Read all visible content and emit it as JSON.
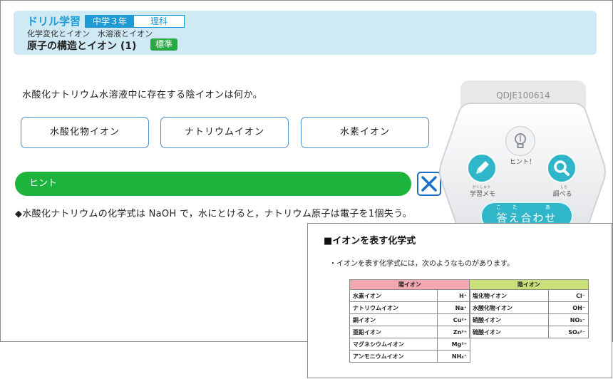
{
  "header": {
    "brand": "ドリル学習",
    "grade": "中学３年",
    "subject": "理科",
    "unit_path": "化学変化とイオン　水溶液とイオン",
    "unit_title": "原子の構造とイオン (1)",
    "level": "標準"
  },
  "question": {
    "text": "水酸化ナトリウム水溶液中に存在する陰イオンは何か。",
    "choices": [
      "水酸化物イオン",
      "ナトリウムイオン",
      "水素イオン"
    ]
  },
  "hint": {
    "label": "ヒント",
    "text": "◆水酸化ナトリウムの化学式は NaOH で，水にとけると，ナトリウム原子は電子を1個失う。"
  },
  "side_panel": {
    "question_id": "QDJE100614",
    "hint_button_label": "ヒント！",
    "memo_ruby": "がくしゅう",
    "memo_label": "学習メモ",
    "lookup_ruby": "しら",
    "lookup_label": "調べる",
    "answer_ruby": "こた　あ",
    "answer_label": "答え合わせ"
  },
  "card": {
    "title": "■イオンを表す化学式",
    "description": "・イオンを表す化学式には，次のようなものがあります。",
    "cation_header": "陽イオン",
    "anion_header": "陰イオン",
    "cations": [
      {
        "name": "水素イオン",
        "formula": "H⁺"
      },
      {
        "name": "ナトリウムイオン",
        "formula": "Na⁺"
      },
      {
        "name": "銅イオン",
        "formula": "Cu²⁺"
      },
      {
        "name": "亜鉛イオン",
        "formula": "Zn²⁺"
      },
      {
        "name": "マグネシウムイオン",
        "formula": "Mg²⁺"
      },
      {
        "name": "アンモニウムイオン",
        "formula": "NH₄⁺"
      }
    ],
    "anions": [
      {
        "name": "塩化物イオン",
        "formula": "Cl⁻"
      },
      {
        "name": "水酸化物イオン",
        "formula": "OH⁻"
      },
      {
        "name": "硝酸イオン",
        "formula": "NO₃⁻"
      },
      {
        "name": "硫酸イオン",
        "formula": "SO₄²⁻"
      }
    ]
  },
  "colors": {
    "brand_blue": "#1e9bd7",
    "header_bg": "#cfe9f5",
    "hint_green": "#1db43e",
    "level_green": "#28a844",
    "teal": "#2fb7c9",
    "cation_pink": "#f3a7b0",
    "anion_green": "#c9e07a"
  }
}
